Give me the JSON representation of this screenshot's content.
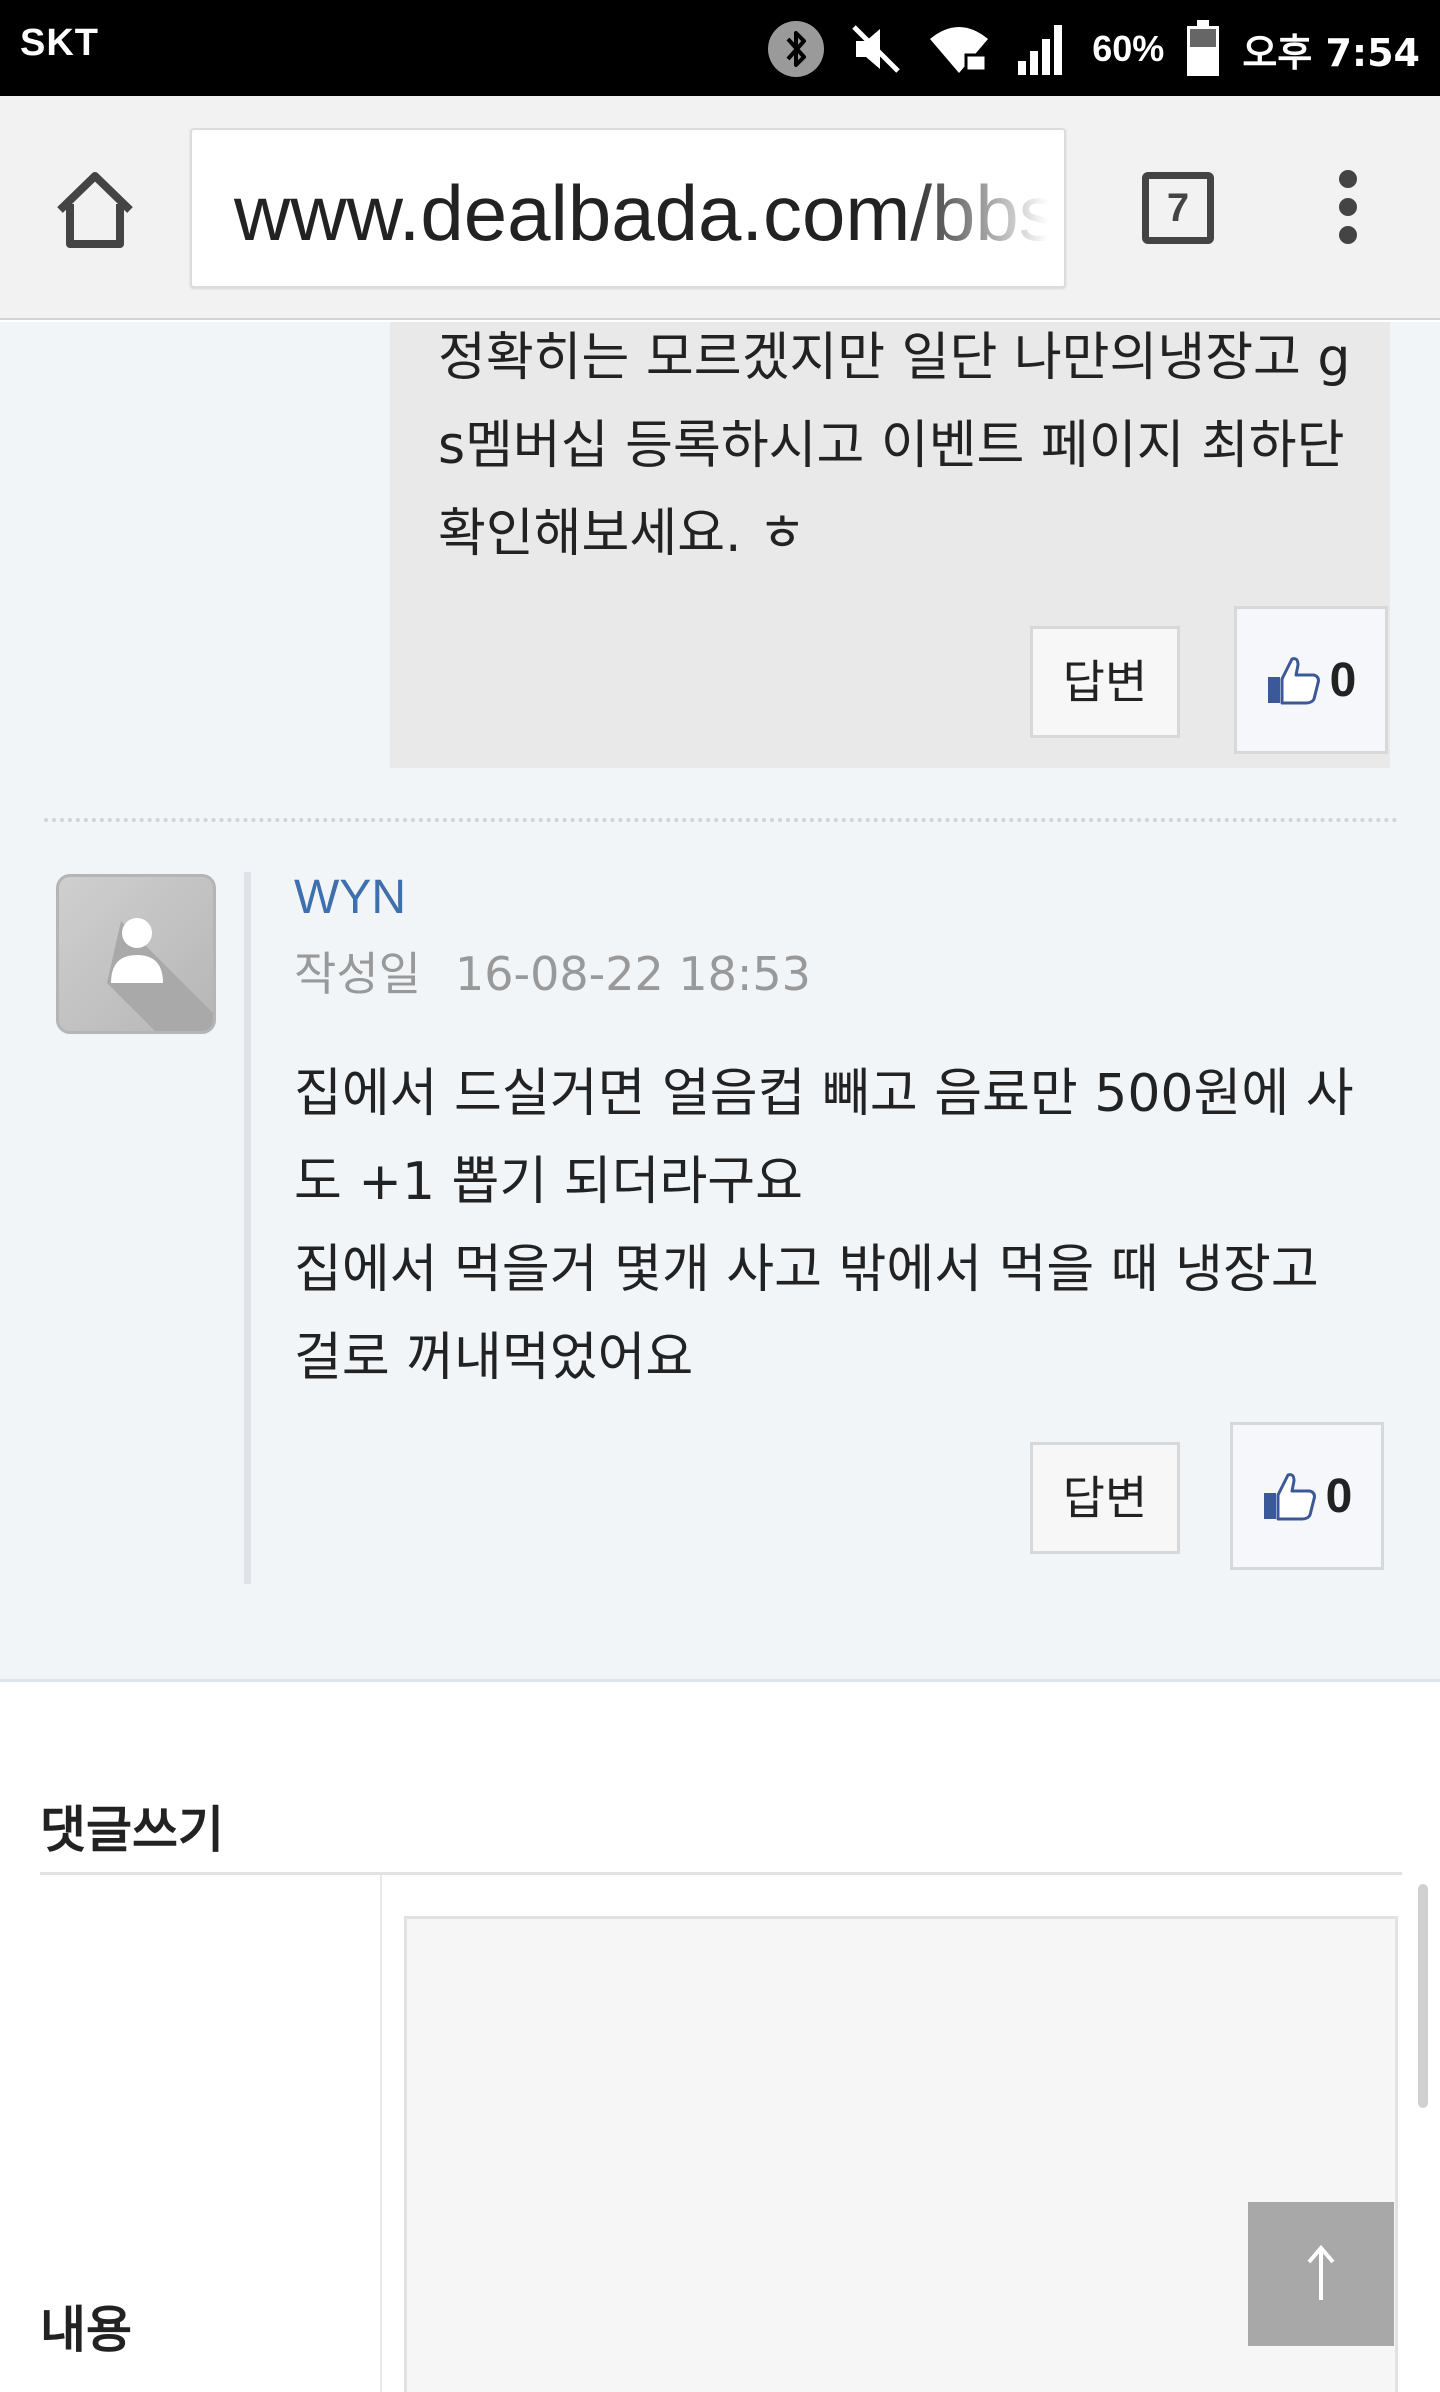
{
  "status_bar": {
    "carrier": "SKT",
    "battery_percent": "60%",
    "time": "오후 7:54",
    "icons": [
      "bluetooth-icon",
      "mute-icon",
      "wifi-icon",
      "signal-icon",
      "battery-icon"
    ]
  },
  "browser": {
    "url": "www.dealbada.com/bbs",
    "tab_count": "7",
    "icons": [
      "home-icon",
      "menu-icon"
    ]
  },
  "comments": [
    {
      "text_lines": [
        "정확히는 모르겠지만 일단 나만의냉장고 g",
        "s멤버십 등록하시고 이벤트 페이지 최하단",
        "확인해보세요. ㅎ"
      ],
      "reply_label": "답변",
      "likes": "0"
    },
    {
      "author": "WYN",
      "date_label": "작성일",
      "date": "16-08-22 18:53",
      "text_lines": [
        "집에서 드실거면 얼음컵 빼고 음료만 500원에 사",
        "도 +1 뽑기 되더라구요",
        "집에서 먹을거 몇개 사고 밖에서 먹을 때 냉장고",
        "걸로 꺼내먹었어요"
      ],
      "reply_label": "답변",
      "likes": "0"
    }
  ],
  "write_comment": {
    "title": "댓글쓰기",
    "content_label": "내용",
    "scroll_top_label": "↑"
  },
  "colors": {
    "author_link": "#3e70ad",
    "comment_bg": "#f1f5f8",
    "reply_bg": "#e9e9e9",
    "like_icon": "#3b5998"
  }
}
